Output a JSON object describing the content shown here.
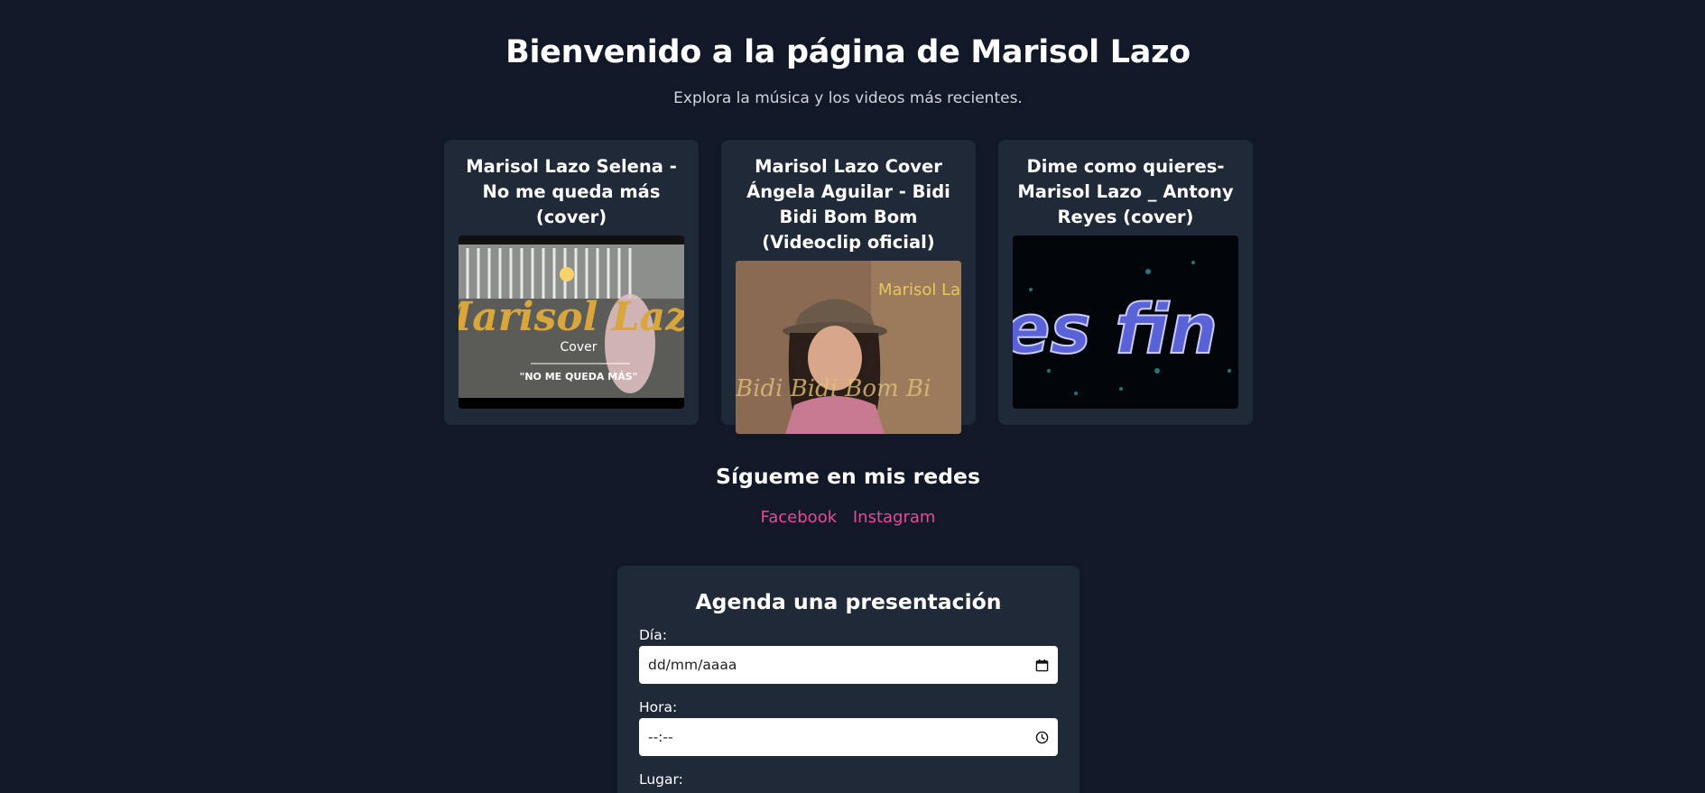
{
  "header": {
    "title": "Bienvenido a la página de Marisol Lazo",
    "subtitle": "Explora la música y los videos más recientes."
  },
  "videos": [
    {
      "title": "Marisol Lazo Selena - No me queda más (cover)",
      "thumb_text": [
        "Marisol Lazo",
        "Cover",
        "\"NO ME QUEDA MÁS\""
      ]
    },
    {
      "title": "Marisol Lazo Cover Ángela Aguilar - Bidi Bidi Bom Bom (Videoclip oficial)",
      "thumb_text": [
        "Marisol La",
        "Bidi Bidi Bom Bi"
      ]
    },
    {
      "title": "Dime como quieres- Marisol Lazo _ Antony Reyes (cover)",
      "thumb_text": [
        "es fin"
      ]
    }
  ],
  "social": {
    "title": "Sígueme en mis redes",
    "links": [
      "Facebook",
      "Instagram"
    ]
  },
  "booking": {
    "title": "Agenda una presentación",
    "day_label": "Día:",
    "day_placeholder": "dd/mm/aaaa",
    "time_label": "Hora:",
    "time_placeholder": "--:--",
    "place_label": "Lugar:"
  },
  "colors": {
    "background": "#111827",
    "card": "#1f2937",
    "link": "#ec4899"
  },
  "icons": [
    "calendar-icon",
    "clock-icon"
  ]
}
